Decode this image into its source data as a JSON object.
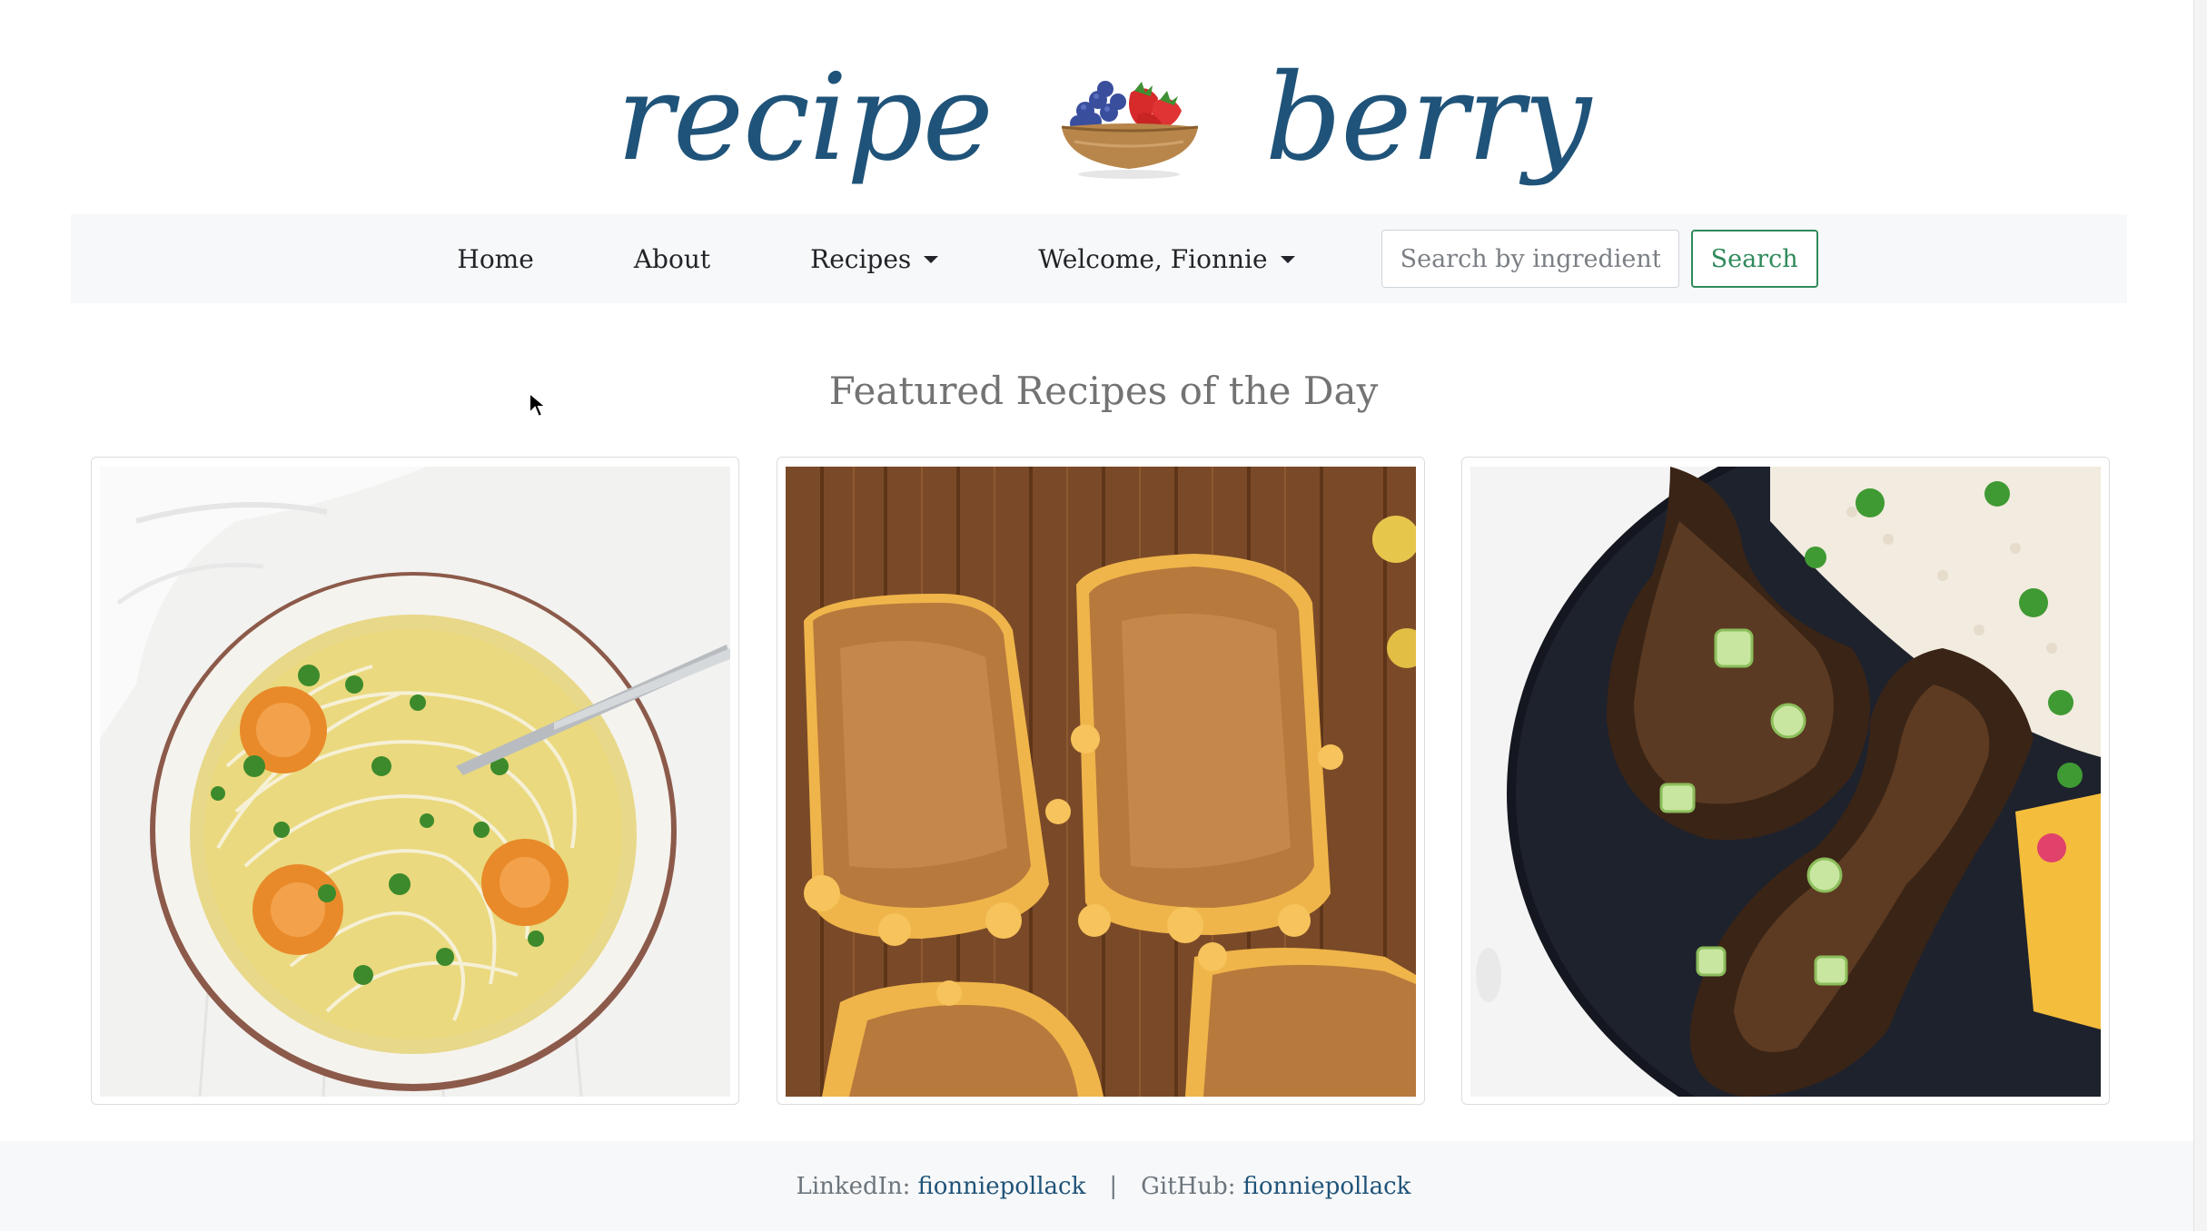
{
  "logo": {
    "word_left": "recipe",
    "word_right": "berry",
    "icon": "berry-bowl-icon"
  },
  "nav": {
    "items": [
      {
        "label": "Home"
      },
      {
        "label": "About"
      },
      {
        "label": "Recipes",
        "dropdown": true
      },
      {
        "label": "Welcome, Fionnie",
        "dropdown": true
      }
    ],
    "search_placeholder": "Search by ingredient",
    "search_value": "",
    "search_button": "Search"
  },
  "main": {
    "title": "Featured Recipes of the Day",
    "cards": [
      {
        "image": "noodle-soup-image"
      },
      {
        "image": "grilled-mac-cheese-image"
      },
      {
        "image": "jerk-chicken-image"
      }
    ]
  },
  "footer": {
    "linkedin_label": "LinkedIn:",
    "linkedin_value": "fionniepollack",
    "separator": "|",
    "github_label": "GitHub:",
    "github_value": "fionniepollack"
  },
  "colors": {
    "brand": "#1f5379",
    "search_accent": "#2f8a5b",
    "nav_bg": "#f7f8f9"
  }
}
